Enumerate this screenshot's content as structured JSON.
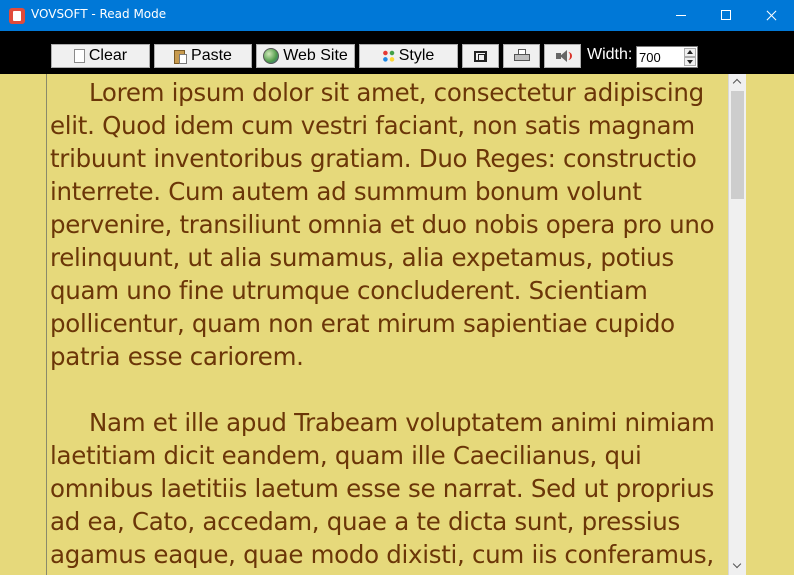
{
  "window": {
    "title": "VOVSOFT - Read Mode"
  },
  "toolbar": {
    "clear_label": "Clear",
    "paste_label": "Paste",
    "website_label": "Web Site",
    "style_label": "Style",
    "width_label": "Width:",
    "width_value": "700"
  },
  "content": {
    "paragraphs": [
      "Lorem ipsum dolor sit amet, consectetur adipiscing elit. Quod idem cum vestri faciant, non satis magnam tribuunt inventoribus gratiam. Duo Reges: constructio interrete. Cum autem ad summum bonum volunt pervenire, transiliunt omnia et duo nobis opera pro uno relinquunt, ut alia sumamus, alia expetamus, potius quam uno fine utrumque concluderent. Scientiam pollicentur, quam non erat mirum sapientiae cupido patria esse cariorem.",
      "Nam et ille apud Trabeam voluptatem animi nimiam laetitiam dicit eandem, quam ille Caecilianus, qui omnibus laetitiis laetum esse se narrat. Sed ut proprius ad ea, Cato, accedam, quae a te dicta sunt, pressius agamus eaque, quae modo dixisti, cum iis conferamus,"
    ]
  },
  "colors": {
    "titlebar": "#0078d7",
    "toolbar": "#000000",
    "reading_background": "#e6d97b",
    "text": "#6b3608"
  },
  "icons": [
    "app-icon",
    "page-icon",
    "clipboard-icon",
    "globe-icon",
    "palette-icon",
    "fit-icon",
    "printer-icon",
    "speaker-icon"
  ]
}
